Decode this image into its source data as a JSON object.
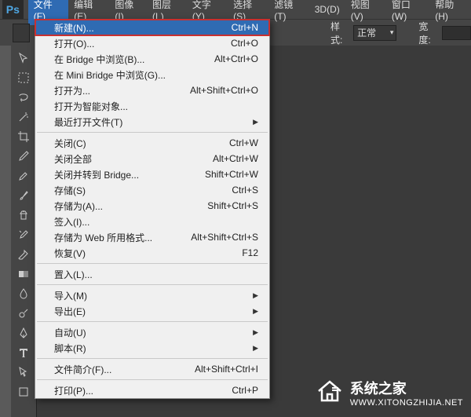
{
  "menubar": {
    "logo": "Ps",
    "items": [
      {
        "label": "文件(F)",
        "active": true
      },
      {
        "label": "编辑(E)"
      },
      {
        "label": "图像(I)"
      },
      {
        "label": "图层(L)"
      },
      {
        "label": "文字(Y)"
      },
      {
        "label": "选择(S)"
      },
      {
        "label": "滤镜(T)"
      },
      {
        "label": "3D(D)"
      },
      {
        "label": "视图(V)"
      },
      {
        "label": "窗口(W)"
      },
      {
        "label": "帮助(H)"
      }
    ]
  },
  "options": {
    "style_label": "样式:",
    "style_value": "正常",
    "width_label": "宽度:"
  },
  "dropdown": [
    {
      "label": "新建(N)...",
      "shortcut": "Ctrl+N",
      "highlight": true
    },
    {
      "label": "打开(O)...",
      "shortcut": "Ctrl+O"
    },
    {
      "label": "在 Bridge 中浏览(B)...",
      "shortcut": "Alt+Ctrl+O"
    },
    {
      "label": "在 Mini Bridge 中浏览(G)..."
    },
    {
      "label": "打开为...",
      "shortcut": "Alt+Shift+Ctrl+O"
    },
    {
      "label": "打开为智能对象..."
    },
    {
      "label": "最近打开文件(T)",
      "submenu": true
    },
    {
      "sep": true
    },
    {
      "label": "关闭(C)",
      "shortcut": "Ctrl+W"
    },
    {
      "label": "关闭全部",
      "shortcut": "Alt+Ctrl+W"
    },
    {
      "label": "关闭并转到 Bridge...",
      "shortcut": "Shift+Ctrl+W"
    },
    {
      "label": "存储(S)",
      "shortcut": "Ctrl+S"
    },
    {
      "label": "存储为(A)...",
      "shortcut": "Shift+Ctrl+S"
    },
    {
      "label": "签入(I)..."
    },
    {
      "label": "存储为 Web 所用格式...",
      "shortcut": "Alt+Shift+Ctrl+S"
    },
    {
      "label": "恢复(V)",
      "shortcut": "F12"
    },
    {
      "sep": true
    },
    {
      "label": "置入(L)..."
    },
    {
      "sep": true
    },
    {
      "label": "导入(M)",
      "submenu": true
    },
    {
      "label": "导出(E)",
      "submenu": true
    },
    {
      "sep": true
    },
    {
      "label": "自动(U)",
      "submenu": true
    },
    {
      "label": "脚本(R)",
      "submenu": true
    },
    {
      "sep": true
    },
    {
      "label": "文件简介(F)...",
      "shortcut": "Alt+Shift+Ctrl+I"
    },
    {
      "sep": true
    },
    {
      "label": "打印(P)...",
      "shortcut": "Ctrl+P"
    }
  ],
  "tools": [
    "move",
    "marquee",
    "lasso",
    "wand",
    "crop",
    "eyedropper",
    "healing",
    "brush",
    "clone",
    "history",
    "eraser",
    "gradient",
    "blur",
    "dodge",
    "pen",
    "type",
    "path",
    "rect"
  ],
  "watermark": {
    "title": "系统之家",
    "url": "WWW.XITONGZHIJIA.NET"
  }
}
